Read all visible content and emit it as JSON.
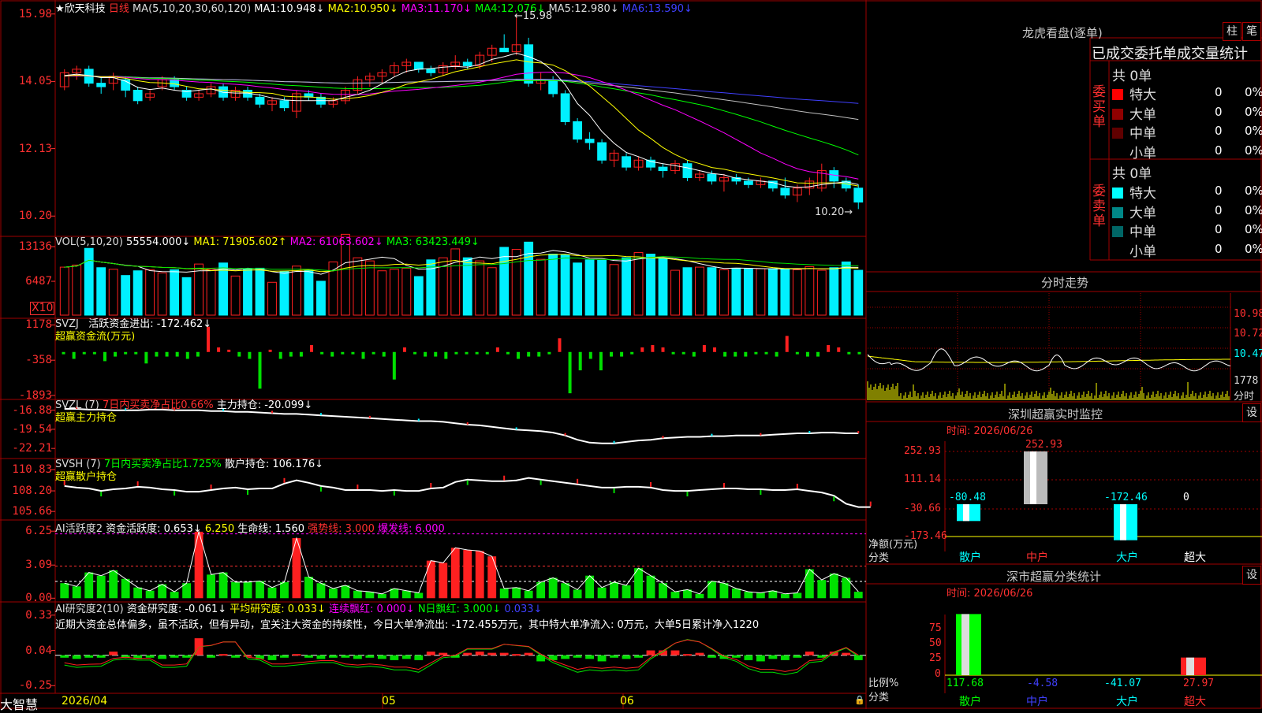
{
  "colors": {
    "up": "#ff2020",
    "down": "#00f0ff",
    "grid": "#a00000",
    "axis": "#ff3030",
    "bg": "#000000",
    "ma1": "#ffffff",
    "ma2": "#ffff00",
    "ma3": "#ff00ff",
    "ma4": "#00ff00",
    "ma5": "#c0c0c0",
    "ma6": "#4040ff",
    "green": "#00e000",
    "yellow": "#ffff00",
    "magenta": "#ff00ff"
  },
  "stock": {
    "name": "欣天科技",
    "period": "日线",
    "star": "★"
  },
  "price_panel": {
    "ma_header": "MA(5,10,20,30,60,120)",
    "ma": [
      {
        "label": "MA1:",
        "value": "10.948↓"
      },
      {
        "label": "MA2:",
        "value": "10.950↓"
      },
      {
        "label": "MA3:",
        "value": "11.170↓"
      },
      {
        "label": "MA4:",
        "value": "12.076↓"
      },
      {
        "label": "MA5:",
        "value": "12.980↓"
      },
      {
        "label": "MA6:",
        "value": "13.590↓"
      }
    ],
    "axis": [
      "15.98",
      "14.05",
      "12.13",
      "10.20"
    ],
    "high_label": "←15.98",
    "low_label": "10.20→",
    "axis_range": [
      9.8,
      16.2
    ]
  },
  "vol_panel": {
    "title": "VOL(5,10,20)",
    "value": "55554.000↓",
    "ma1": "MA1: 71905.602↑",
    "ma2": "MA2: 61063.602↓",
    "ma3": "MA3: 63423.449↓",
    "axis": [
      "13136",
      "6487"
    ],
    "unit": "X10",
    "axis_max": 14500
  },
  "svzj_panel": {
    "title": "SVZJ",
    "label": "活跃资金进出: -172.462↓",
    "sub": "超赢资金流(万元)",
    "axis": [
      "1178",
      "-358",
      "-1893"
    ],
    "range": [
      -2000,
      1400
    ]
  },
  "svzl_panel": {
    "title": "SVZL (7)",
    "label1": "7日内买卖净占比0.66%",
    "label2": "主力持仓: -20.099↓",
    "sub": "超赢主力持仓",
    "axis": [
      "-16.88",
      "-19.54",
      "-22.21"
    ],
    "range": [
      -23.4,
      -15.6
    ]
  },
  "svsh_panel": {
    "title": "SVSH (7)",
    "label1": "7日内买卖净占比1.725%",
    "label2": "散户持仓: 106.176↓",
    "sub": "超赢散户持仓",
    "axis": [
      "110.83",
      "108.20",
      "105.66"
    ],
    "range": [
      104.8,
      112.0
    ]
  },
  "ai1_panel": {
    "title": "AI活跃度2",
    "l1": "资金活跃度: 0.653↓",
    "l2": "6.250",
    "l3": "生命线: 1.560",
    "l4": "强势线: 3.000",
    "l5": "爆发线: 6.000",
    "axis": [
      "6.25",
      "3.09",
      "0.00"
    ],
    "range": [
      -0.2,
      7.0
    ]
  },
  "ai2_panel": {
    "title": "AI研究度2(10)",
    "l1": "资金研究度: -0.061↓",
    "l2": "平均研究度: 0.033↓",
    "l3": "连续飘红: 0.000↓",
    "l4": "N日飘红: 3.000↓",
    "l5": "0.033↓",
    "comment": "近期大资金总体偏多，虽不活跃，但有异动，宜关注大资金的持续性，今日大单净流出: -172.455万元，其中特大单净流入: 0万元，大单5日累计净入1220",
    "axis": [
      "0.33",
      "0.04",
      "-0.25"
    ],
    "range": [
      -0.3,
      0.4
    ]
  },
  "bottom_bar": {
    "brand": "大智慧",
    "dates": [
      "2026/04",
      "05",
      "06"
    ]
  },
  "right": {
    "dragon_title": "龙虎看盘(逐单)",
    "btn_zhu": "柱",
    "btn_bi": "笔",
    "stats_header": "已成交委托单成交量统计",
    "buy": {
      "label": "委买单",
      "total": "共 0单",
      "rows": [
        {
          "name": "特大",
          "count": "0",
          "pct": "0%",
          "color": "#ff0000"
        },
        {
          "name": "大单",
          "count": "0",
          "pct": "0%",
          "color": "#900000"
        },
        {
          "name": "中单",
          "count": "0",
          "pct": "0%",
          "color": "#600000"
        },
        {
          "name": "小单",
          "count": "0",
          "pct": "0%",
          "color": "#000000"
        }
      ]
    },
    "sell": {
      "label": "委卖单",
      "total": "共 0单",
      "rows": [
        {
          "name": "特大",
          "count": "0",
          "pct": "0%",
          "color": "#00ffff"
        },
        {
          "name": "大单",
          "count": "0",
          "pct": "0%",
          "color": "#008888"
        },
        {
          "name": "中单",
          "count": "0",
          "pct": "0%",
          "color": "#006666"
        },
        {
          "name": "小单",
          "count": "0",
          "pct": "0%",
          "color": "#000000"
        }
      ]
    },
    "fenshi_title": "分时走势",
    "fenshi_axis": [
      "10.98",
      "10.72",
      "10.47",
      "1778"
    ],
    "fenshi_unit": "分时",
    "monitor_title": "深圳超赢实时监控",
    "monitor_btn": "设",
    "monitor_time": "时间: 2026/06/26",
    "monitor_axis": [
      "252.93",
      "111.14",
      "-30.66",
      "-173.46"
    ],
    "monitor_unit1": "净额(万元)",
    "monitor_unit2": "分类",
    "monitor_bars": [
      {
        "cat": "散户",
        "value": "-80.48"
      },
      {
        "cat": "中户",
        "value": "252.93"
      },
      {
        "cat": "大户",
        "value": "-172.46"
      },
      {
        "cat": "超大",
        "value": "0"
      }
    ],
    "class_title": "深市超赢分类统计",
    "class_btn": "设",
    "class_time": "时间: 2026/06/26",
    "class_axis": [
      "75",
      "50",
      "25",
      "0"
    ],
    "class_unit1": "比例%",
    "class_unit2": "分类",
    "class_bars": [
      {
        "cat": "散户",
        "value": "117.68"
      },
      {
        "cat": "中户",
        "value": "-4.58"
      },
      {
        "cat": "大户",
        "value": "-41.07"
      },
      {
        "cat": "超大",
        "value": "27.97"
      }
    ]
  },
  "chart_data": {
    "type": "bar",
    "title": "",
    "candles": [
      [
        13.9,
        14.4,
        13.8,
        14.3
      ],
      [
        14.3,
        14.5,
        14.1,
        14.4
      ],
      [
        14.4,
        14.5,
        13.9,
        14.0
      ],
      [
        14.0,
        14.2,
        13.7,
        13.9
      ],
      [
        14.0,
        14.3,
        13.8,
        14.2
      ],
      [
        14.1,
        14.2,
        13.6,
        13.8
      ],
      [
        13.8,
        13.9,
        13.4,
        13.5
      ],
      [
        13.6,
        13.8,
        13.5,
        13.7
      ],
      [
        13.9,
        14.2,
        13.8,
        14.1
      ],
      [
        14.1,
        14.2,
        13.8,
        13.9
      ],
      [
        13.8,
        13.9,
        13.5,
        13.6
      ],
      [
        13.6,
        13.8,
        13.5,
        13.7
      ],
      [
        13.7,
        14.0,
        13.6,
        13.9
      ],
      [
        13.9,
        14.0,
        13.5,
        13.6
      ],
      [
        13.6,
        13.9,
        13.5,
        13.8
      ],
      [
        13.8,
        13.9,
        13.5,
        13.6
      ],
      [
        13.6,
        13.7,
        13.3,
        13.4
      ],
      [
        13.4,
        13.6,
        13.2,
        13.5
      ],
      [
        13.5,
        13.6,
        13.2,
        13.3
      ],
      [
        13.2,
        13.8,
        13.0,
        13.7
      ],
      [
        13.7,
        13.8,
        13.5,
        13.6
      ],
      [
        13.6,
        13.7,
        13.3,
        13.4
      ],
      [
        13.4,
        13.6,
        13.3,
        13.5
      ],
      [
        13.5,
        13.9,
        13.4,
        13.8
      ],
      [
        13.8,
        14.2,
        13.7,
        14.1
      ],
      [
        14.1,
        14.3,
        13.9,
        14.2
      ],
      [
        14.2,
        14.4,
        14.0,
        14.3
      ],
      [
        14.3,
        14.6,
        14.2,
        14.5
      ],
      [
        14.5,
        14.7,
        14.3,
        14.6
      ],
      [
        14.6,
        14.6,
        14.3,
        14.4
      ],
      [
        14.4,
        14.5,
        14.2,
        14.3
      ],
      [
        14.3,
        14.6,
        14.2,
        14.5
      ],
      [
        14.5,
        14.8,
        14.4,
        14.6
      ],
      [
        14.6,
        14.7,
        14.4,
        14.5
      ],
      [
        14.5,
        14.9,
        14.4,
        14.8
      ],
      [
        14.8,
        15.1,
        14.6,
        15.0
      ],
      [
        15.0,
        15.4,
        14.9,
        14.9
      ],
      [
        14.9,
        15.98,
        14.8,
        15.1
      ],
      [
        15.1,
        15.3,
        13.9,
        14.0
      ],
      [
        14.0,
        14.3,
        13.8,
        14.1
      ],
      [
        14.1,
        14.2,
        13.6,
        13.7
      ],
      [
        13.7,
        13.8,
        12.8,
        12.9
      ],
      [
        12.9,
        13.0,
        12.3,
        12.4
      ],
      [
        12.4,
        12.6,
        12.1,
        12.3
      ],
      [
        12.3,
        12.4,
        11.7,
        11.8
      ],
      [
        11.8,
        12.1,
        11.6,
        12.0
      ],
      [
        11.9,
        12.0,
        11.5,
        11.6
      ],
      [
        11.6,
        11.9,
        11.5,
        11.8
      ],
      [
        11.8,
        11.9,
        11.5,
        11.6
      ],
      [
        11.6,
        11.7,
        11.3,
        11.5
      ],
      [
        11.5,
        11.8,
        11.4,
        11.7
      ],
      [
        11.7,
        11.8,
        11.2,
        11.3
      ],
      [
        11.3,
        11.5,
        11.2,
        11.4
      ],
      [
        11.4,
        11.5,
        11.1,
        11.2
      ],
      [
        11.2,
        11.4,
        10.9,
        11.3
      ],
      [
        11.3,
        11.4,
        11.1,
        11.2
      ],
      [
        11.2,
        11.3,
        11.0,
        11.1
      ],
      [
        11.1,
        11.3,
        11.0,
        11.2
      ],
      [
        11.2,
        11.2,
        10.9,
        11.0
      ],
      [
        11.0,
        11.3,
        10.7,
        10.8
      ],
      [
        10.8,
        11.1,
        10.6,
        11.0
      ],
      [
        11.0,
        11.3,
        10.8,
        11.2
      ],
      [
        11.0,
        11.7,
        10.9,
        11.5
      ],
      [
        11.5,
        11.6,
        11.0,
        11.2
      ],
      [
        11.2,
        11.3,
        10.9,
        11.0
      ],
      [
        11.0,
        11.1,
        10.4,
        10.6
      ]
    ],
    "volume": [
      9200,
      9600,
      12800,
      9100,
      8800,
      7600,
      8500,
      8700,
      8100,
      8700,
      7200,
      9800,
      8800,
      10000,
      7500,
      8900,
      9000,
      6300,
      8400,
      9400,
      8600,
      6500,
      10200,
      15500,
      11000,
      10400,
      8500,
      8800,
      9000,
      7400,
      10600,
      11000,
      12700,
      11000,
      10400,
      9100,
      13000,
      12600,
      14000,
      10700,
      11700,
      11600,
      10000,
      10600,
      10500,
      9700,
      11000,
      12000,
      11700,
      10800,
      8600,
      9100,
      9200,
      9100,
      8700,
      9000,
      8900,
      8900,
      8900,
      8800,
      8700,
      9300,
      8600,
      9100,
      10200,
      8600
    ],
    "svzj": [
      -100,
      -300,
      -100,
      -100,
      -400,
      -200,
      -100,
      -100,
      -500,
      -200,
      -200,
      -200,
      -300,
      -200,
      1100,
      200,
      100,
      -200,
      -300,
      -1600,
      100,
      -300,
      -200,
      -200,
      300,
      -100,
      -200,
      -100,
      -100,
      -300,
      -100,
      -200,
      -1200,
      200,
      -100,
      -200,
      -200,
      -300,
      -100,
      -100,
      -100,
      -100,
      200,
      -100,
      -300,
      -200,
      -200,
      -100,
      600,
      -1800,
      -800,
      -300,
      -800,
      -200,
      -200,
      -100,
      200,
      300,
      200,
      -100,
      -100,
      -200,
      300,
      200,
      -200,
      -200,
      -200,
      -100,
      -100,
      -200,
      700,
      -100,
      -200,
      -200,
      300,
      200,
      -100,
      -100
    ],
    "svzl": [
      -16.7,
      -16.7,
      -16.8,
      -16.8,
      -16.9,
      -16.9,
      -16.9,
      -16.8,
      -16.8,
      -16.9,
      -16.9,
      -16.9,
      -17.0,
      -17.0,
      -17.1,
      -17.1,
      -17.2,
      -17.3,
      -17.4,
      -17.4,
      -17.5,
      -17.6,
      -17.7,
      -17.8,
      -17.9,
      -18.0,
      -18.1,
      -18.2,
      -18.3,
      -18.4,
      -18.4,
      -18.5,
      -18.7,
      -18.9,
      -19.0,
      -19.2,
      -19.4,
      -19.6,
      -19.7,
      -19.8,
      -20.0,
      -20.4,
      -21.0,
      -21.4,
      -21.5,
      -21.5,
      -21.3,
      -21.1,
      -21.0,
      -20.8,
      -20.7,
      -20.6,
      -20.6,
      -20.5,
      -20.5,
      -20.4,
      -20.4,
      -20.4,
      -20.3,
      -20.2,
      -20.1,
      -20.1,
      -20.0,
      -20.0,
      -20.1,
      -20.1
    ],
    "svsh": [
      108.8,
      108.6,
      108.5,
      108.2,
      108.4,
      108.5,
      108.7,
      108.6,
      108.4,
      108.3,
      108.1,
      108.1,
      108.3,
      108.5,
      108.6,
      108.4,
      108.5,
      108.5,
      109.1,
      109.5,
      109.2,
      108.8,
      108.6,
      108.3,
      108.3,
      108.3,
      108.2,
      108.3,
      108.2,
      108.2,
      108.5,
      108.6,
      109.3,
      109.6,
      109.5,
      109.4,
      109.4,
      109.5,
      109.8,
      109.6,
      109.4,
      109.2,
      109.0,
      108.8,
      108.6,
      108.6,
      108.7,
      108.7,
      108.6,
      108.3,
      108.2,
      108.2,
      108.3,
      108.4,
      108.5,
      108.5,
      108.4,
      108.4,
      108.3,
      108.3,
      108.4,
      108.2,
      108.0,
      107.6,
      106.6,
      106.2,
      106.2
    ],
    "ai1": [
      1.4,
      1.1,
      2.4,
      2.1,
      2.6,
      1.8,
      1.0,
      0.7,
      1.3,
      0.6,
      1.4,
      6.2,
      2.2,
      2.4,
      1.5,
      1.5,
      1.6,
      1.0,
      1.5,
      5.6,
      2.0,
      1.4,
      0.9,
      1.2,
      0.7,
      0.6,
      0.4,
      0.9,
      0.7,
      0.5,
      3.5,
      3.3,
      4.7,
      4.5,
      4.4,
      3.9,
      0.9,
      1.0,
      0.7,
      1.5,
      1.9,
      1.4,
      0.8,
      2.1,
      1.0,
      1.5,
      1.2,
      2.8,
      2.1,
      1.4,
      0.6,
      0.8,
      0.4,
      1.6,
      1.4,
      0.9,
      0.6,
      0.5,
      0.7,
      0.4,
      0.5,
      2.7,
      1.7,
      2.3,
      1.9,
      0.6
    ],
    "ai2": [
      -0.02,
      -0.03,
      -0.02,
      -0.02,
      0.03,
      -0.02,
      -0.03,
      -0.02,
      -0.03,
      -0.02,
      -0.02,
      0.14,
      -0.02,
      0.01,
      -0.02,
      0.0,
      -0.03,
      -0.04,
      -0.02,
      0.01,
      -0.02,
      -0.03,
      -0.02,
      -0.02,
      -0.03,
      -0.02,
      -0.03,
      -0.04,
      -0.03,
      -0.04,
      0.03,
      0.02,
      -0.02,
      0.02,
      0.03,
      0.02,
      0.02,
      0.01,
      0.02,
      -0.05,
      -0.04,
      -0.03,
      -0.02,
      -0.03,
      -0.05,
      -0.02,
      -0.03,
      -0.02,
      0.04,
      0.04,
      0.04,
      0.01,
      0.02,
      -0.02,
      -0.03,
      -0.02,
      -0.04,
      -0.05,
      -0.03,
      -0.04,
      -0.02,
      0.03,
      -0.02,
      0.03,
      0.02,
      -0.04
    ]
  }
}
